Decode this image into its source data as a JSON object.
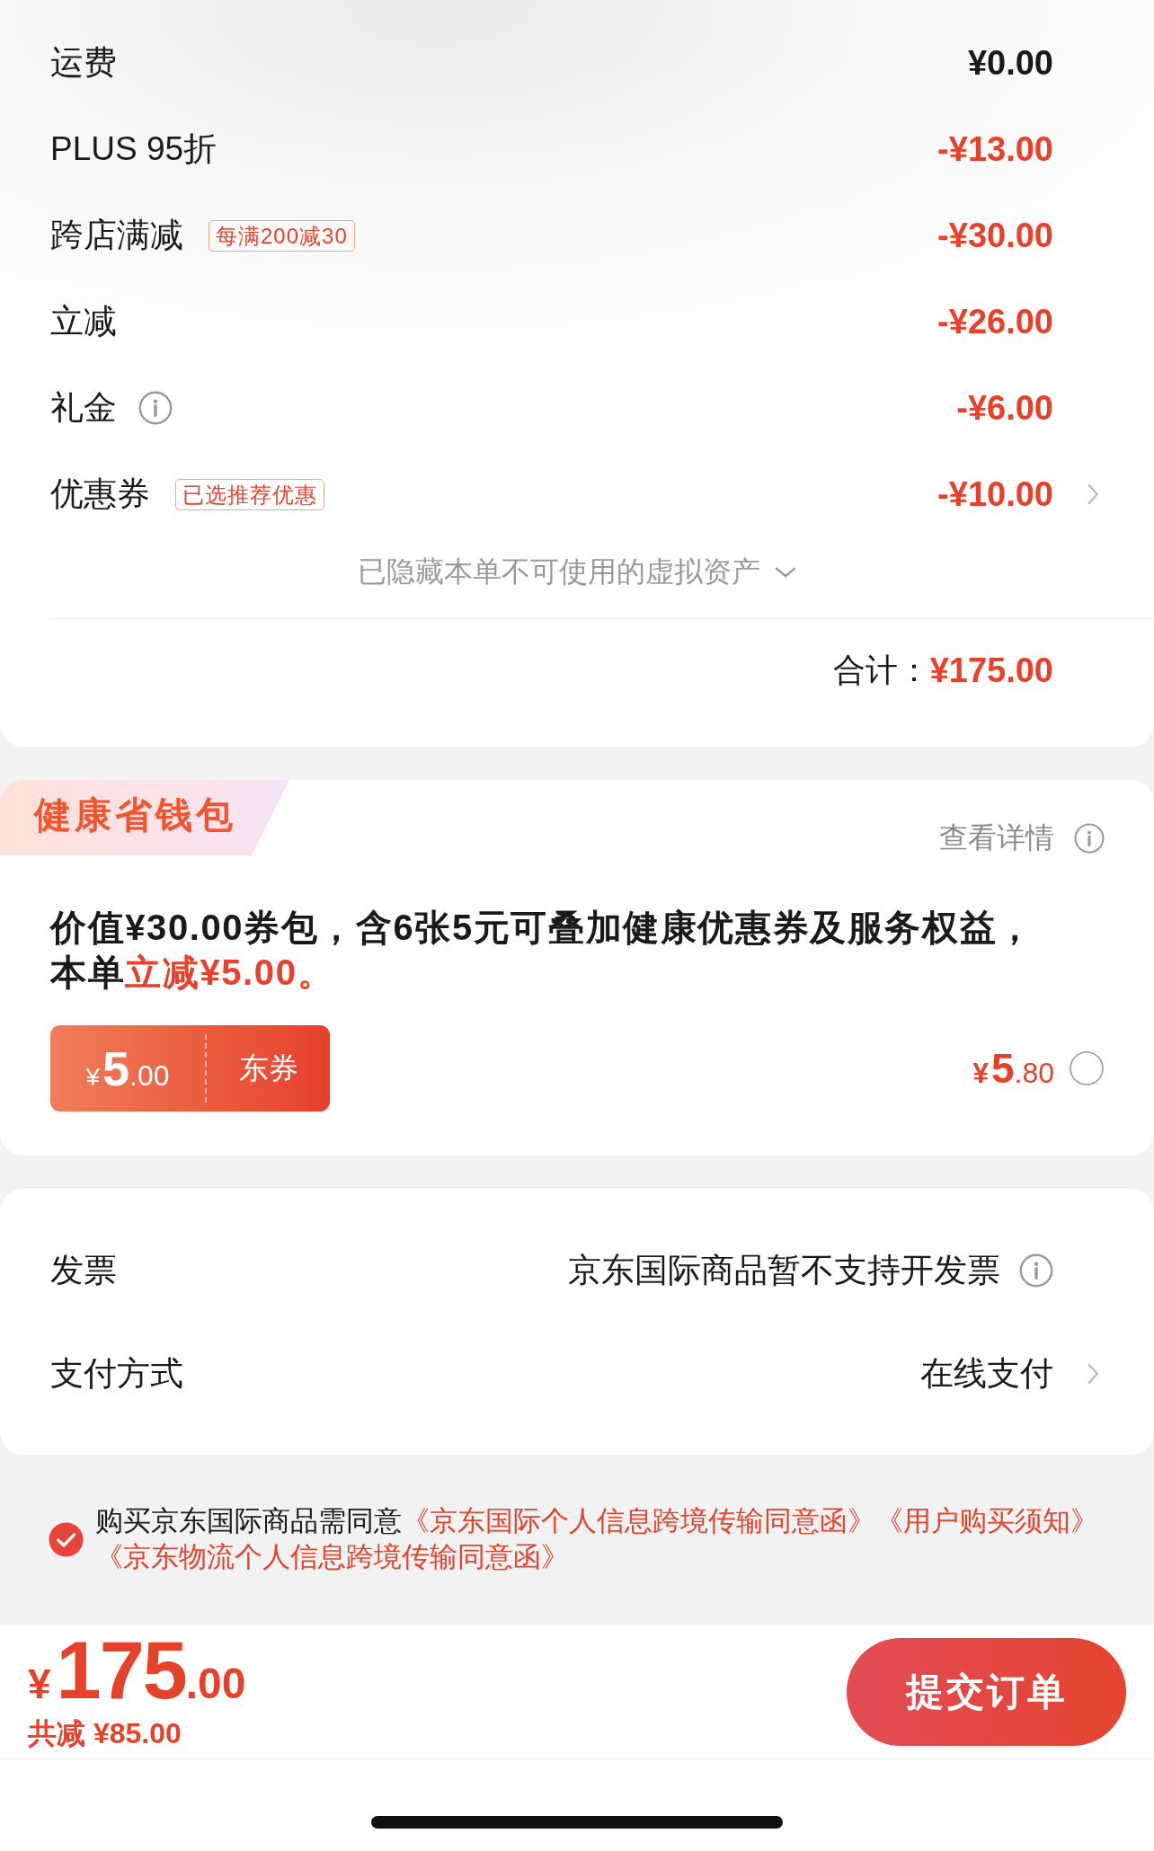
{
  "price_details": {
    "rows": [
      {
        "label": "运费",
        "amount": "¥0.00",
        "discount": false
      },
      {
        "label": "PLUS 95折",
        "amount": "-¥13.00",
        "discount": true
      },
      {
        "label": "跨店满减",
        "tag": "每满200减30",
        "amount": "-¥30.00",
        "discount": true
      },
      {
        "label": "立减",
        "amount": "-¥26.00",
        "discount": true
      },
      {
        "label": "礼金",
        "amount": "-¥6.00",
        "discount": true,
        "info_icon": true
      },
      {
        "label": "优惠券",
        "tag": "已选推荐优惠",
        "amount": "-¥10.00",
        "discount": true,
        "chevron": true
      }
    ],
    "hidden_assets": {
      "text": "已隐藏本单不可使用的虚拟资产",
      "expanded": false
    },
    "total": {
      "label": "合计：",
      "amount": "¥175.00"
    }
  },
  "health_wallet": {
    "title": "健康省钱包",
    "details_link": "查看详情",
    "description": "价值¥30.00券包，含6张5元可叠加健康优惠券及服务权益，本单",
    "description_highlight": "立减¥5.00。",
    "coupon": {
      "currency": "¥",
      "integer": "5",
      "fraction": ".00",
      "label": "东券"
    },
    "price": {
      "currency": "¥",
      "integer": "5",
      "fraction": ".80"
    },
    "selected": false
  },
  "settings": {
    "rows": [
      {
        "label": "发票",
        "value": "京东国际商品暂不支持开发票",
        "info_icon": true
      },
      {
        "label": "支付方式",
        "value": "在线支付",
        "chevron": true
      }
    ]
  },
  "agreement": {
    "checked": true,
    "text": "购买京东国际商品需同意",
    "links": [
      "《京东国际个人信息跨境传输同意函》",
      "《用户购买须知》",
      "《京东物流个人信息跨境传输同意函》"
    ]
  },
  "checkout_bar": {
    "total": {
      "currency": "¥",
      "integer": "175",
      "fraction": ".00"
    },
    "savings": "共减 ¥85.00",
    "submit_button": "提交订单"
  }
}
